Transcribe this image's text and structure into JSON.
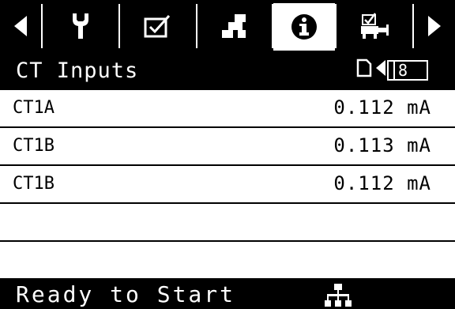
{
  "toolbar": {
    "tabs": [
      {
        "name": "settings",
        "icon": "wrench-icon"
      },
      {
        "name": "checklist",
        "icon": "checkbox-icon"
      },
      {
        "name": "network",
        "icon": "network-icon"
      },
      {
        "name": "info",
        "icon": "info-icon",
        "active": true
      },
      {
        "name": "machine",
        "icon": "machine-check-icon"
      }
    ]
  },
  "header": {
    "title": "CT Inputs",
    "page_number": "8"
  },
  "rows": [
    {
      "label": "CT1A",
      "value": "0.112 mA"
    },
    {
      "label": "CT1B",
      "value": "0.113 mA"
    },
    {
      "label": "CT1B",
      "value": "0.112 mA"
    },
    {
      "label": "",
      "value": ""
    },
    {
      "label": "",
      "value": ""
    }
  ],
  "status": {
    "text": "Ready to Start"
  },
  "colors": {
    "background": "#000000",
    "foreground": "#ffffff"
  }
}
